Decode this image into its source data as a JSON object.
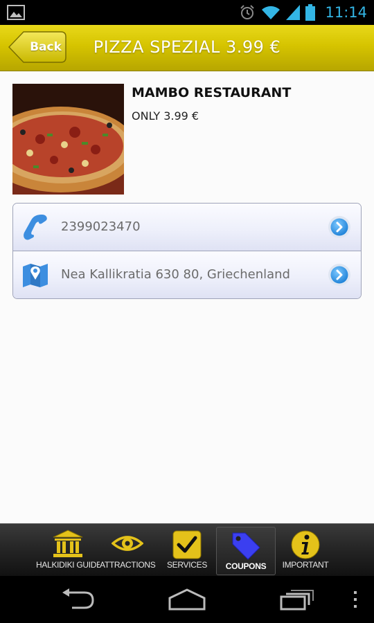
{
  "status_bar": {
    "time": "11:14",
    "icons": [
      "picture-icon",
      "alarm-icon",
      "wifi-icon",
      "signal-icon",
      "battery-icon"
    ],
    "accent_color": "#33b5e5"
  },
  "title_bar": {
    "back_label": "Back",
    "title": "PIZZA SPEZIAL 3.99 €",
    "bar_color": "#d6c400"
  },
  "offer": {
    "restaurant_name": "MAMBO RESTAURANT",
    "price_text": "ONLY 3.99 €"
  },
  "info_rows": [
    {
      "icon": "phone-icon",
      "text": "2399023470",
      "action_icon": "chevron-right-icon"
    },
    {
      "icon": "map-icon",
      "text": "Nea Kallikratia 630 80, Griechenland",
      "action_icon": "chevron-right-icon"
    }
  ],
  "tabs": [
    {
      "label": "HALKIDIKI GUIDE",
      "icon": "museum-icon",
      "active": false
    },
    {
      "label": "ATTRACTIONS",
      "icon": "eye-icon",
      "active": false
    },
    {
      "label": "SERVICES",
      "icon": "checkbox-icon",
      "active": false
    },
    {
      "label": "COUPONS",
      "icon": "tag-icon",
      "active": true
    },
    {
      "label": "IMPORTANT",
      "icon": "info-icon",
      "active": false
    }
  ],
  "nav_bar": {
    "buttons": [
      "back-icon",
      "home-icon",
      "recent-apps-icon",
      "overflow-menu-icon"
    ]
  }
}
